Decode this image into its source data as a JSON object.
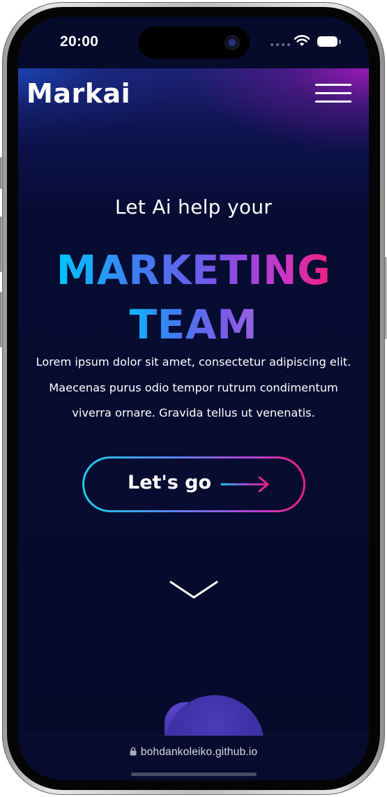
{
  "status_bar": {
    "time": "20:00",
    "icons": [
      "signal-dots-icon",
      "wifi-icon",
      "battery-icon"
    ]
  },
  "header": {
    "logo_text": "Markai",
    "menu_icon": "hamburger-menu-icon"
  },
  "hero": {
    "intro": "Let Ai help your",
    "headline_line1": "MARKETING",
    "headline_line2": "TEAM",
    "description": "Lorem ipsum dolor sit amet, consectetur adipiscing elit. Maecenas purus odio tempor rutrum condimentum viverra ornare. Gravida tellus ut venenatis.",
    "cta_label": "Let's go",
    "cta_icon": "arrow-right-icon",
    "scroll_icon": "chevron-down-icon"
  },
  "browser": {
    "url": "bohdankoleiko.github.io",
    "lock_icon": "lock-icon"
  },
  "colors": {
    "background": "#060b2c",
    "gradient_start": "#00c6ff",
    "gradient_mid": "#7b52e8",
    "gradient_end": "#f0207e",
    "text": "#ffffff"
  }
}
